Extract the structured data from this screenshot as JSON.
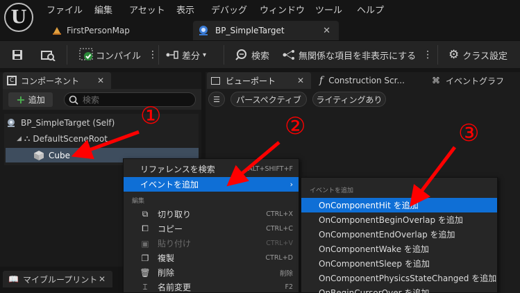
{
  "menu": {
    "items": [
      "ファイル",
      "編集",
      "アセット",
      "表示",
      "デバッグ",
      "ウィンドウ",
      "ツール",
      "ヘルプ"
    ]
  },
  "logo_letter": "U",
  "tabs": [
    {
      "label": "FirstPersonMap"
    },
    {
      "label": "BP_SimpleTarget"
    }
  ],
  "toolbar": {
    "compile_label": "コンパイル",
    "diff_label": "差分",
    "search_label": "検索",
    "hide_unrelated_label": "無関係な項目を非表示にする",
    "class_settings_label": "クラス設定"
  },
  "components_panel": {
    "title": "コンポーネント",
    "add_label": "追加",
    "search_placeholder": "検索",
    "tree": [
      {
        "label": "BP_SimpleTarget (Self)"
      },
      {
        "label": "DefaultSceneRoot"
      },
      {
        "label": "Cube"
      }
    ]
  },
  "right_tabs": [
    {
      "label": "ビューポート"
    },
    {
      "label": "Construction Scr..."
    },
    {
      "label": "イベントグラフ"
    }
  ],
  "viewport": {
    "perspective_label": "パースペクティブ",
    "lighting_label": "ライティングあり"
  },
  "my_blueprint_tab": "マイブループリント",
  "context_menu": {
    "find_references": {
      "label": "リファレンスを検索",
      "shortcut": "ALT+SHIFT+F"
    },
    "add_event": {
      "label": "イベントを追加"
    },
    "edit_header": "編集",
    "edit_items": [
      {
        "label": "切り取り",
        "shortcut": "CTRL+X",
        "icon": "cut-icon",
        "disabled": false
      },
      {
        "label": "コピー",
        "shortcut": "CTRL+C",
        "icon": "copy-icon",
        "disabled": false
      },
      {
        "label": "貼り付け",
        "shortcut": "CTRL+V",
        "icon": "paste-icon",
        "disabled": true
      },
      {
        "label": "複製",
        "shortcut": "CTRL+D",
        "icon": "duplicate-icon",
        "disabled": false
      },
      {
        "label": "削除",
        "shortcut": "削除",
        "icon": "delete-icon",
        "disabled": false
      },
      {
        "label": "名前変更",
        "shortcut": "F2",
        "icon": "rename-icon",
        "disabled": false
      }
    ]
  },
  "submenu": {
    "header": "イベントを追加",
    "items": [
      {
        "label": "OnComponentHit を追加"
      },
      {
        "label": "OnComponentBeginOverlap を追加"
      },
      {
        "label": "OnComponentEndOverlap を追加"
      },
      {
        "label": "OnComponentWake を追加"
      },
      {
        "label": "OnComponentSleep を追加"
      },
      {
        "label": "OnComponentPhysicsStateChanged を追加"
      },
      {
        "label": "OnBeginCursorOver を追加"
      }
    ]
  },
  "annotations": {
    "step1": "①",
    "step2": "②",
    "step3": "③",
    "color": "#ff0000"
  },
  "colors": {
    "accent": "#0f6fd6",
    "background": "#151515",
    "panel": "#242424",
    "selection": "#3e4d5e"
  }
}
